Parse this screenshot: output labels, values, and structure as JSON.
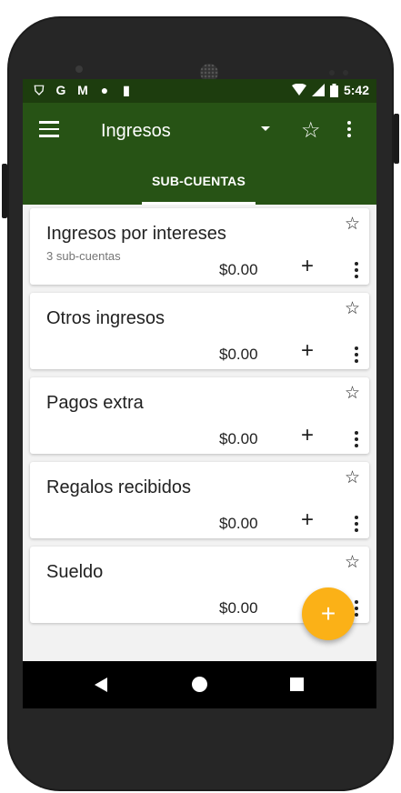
{
  "status_bar": {
    "left_icons": [
      "shield-icon",
      "google-icon",
      "gmail-icon",
      "circle-icon",
      "sd-card-icon"
    ],
    "left_glyphs": [
      "⛉",
      "G",
      "M",
      "●",
      "▮"
    ],
    "time": "5:42"
  },
  "appbar": {
    "title": "Ingresos",
    "tab": "SUB-CUENTAS"
  },
  "accounts": [
    {
      "name": "Ingresos por intereses",
      "sub": "3 sub-cuentas",
      "amount": "$0.00"
    },
    {
      "name": "Otros ingresos",
      "sub": "",
      "amount": "$0.00"
    },
    {
      "name": "Pagos extra",
      "sub": "",
      "amount": "$0.00"
    },
    {
      "name": "Regalos recibidos",
      "sub": "",
      "amount": "$0.00"
    },
    {
      "name": "Sueldo",
      "sub": "",
      "amount": "$0.00"
    }
  ],
  "colors": {
    "appbar": "#275315",
    "statusbar": "#1d3d0e",
    "fab": "#fbb117"
  }
}
